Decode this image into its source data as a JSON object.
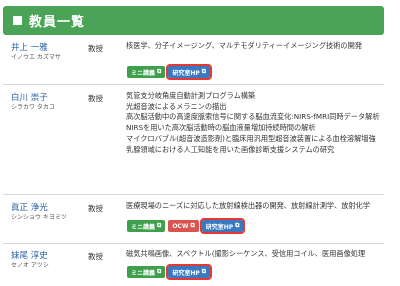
{
  "header": {
    "title": "教員一覧"
  },
  "faculty": [
    {
      "name": "井上 一雅",
      "kana": "イノウエ カズマサ",
      "rank": "教授",
      "topics": [
        "核医学、分子イメージング、マルチモダリティーイメージング技術の開発"
      ],
      "buttons": [
        "ミニ講義",
        "研究室HP"
      ]
    },
    {
      "name": "白川 崇子",
      "kana": "シラカワ タカコ",
      "rank": "教授",
      "topics": [
        "気管支分岐角度自動計測プログラム構築",
        "光超音波によるメラニンの描出",
        "高次脳活動中の高速度脈索信号に関する脳血流変化:NIRS-fMRI同時データ解析",
        "NIRSを用いた高次脳活動時の脳血液量増加持続時間の解析",
        "マイクロバブル(超音波造影剤)と臨床用汎用型超音波装置による血栓溶解増強",
        "乳腺領域における人工知能を用いた画像診断支援システムの研究"
      ],
      "buttons": []
    },
    {
      "name": "眞正 浄光",
      "kana": "シンショウ キヨミツ",
      "rank": "教授",
      "topics": [
        "医療現場のニーズに対応した放射線検出器の開発、放射線計測学、放射化学"
      ],
      "buttons": [
        "ミニ講義",
        "OCW",
        "研究室HP"
      ]
    },
    {
      "name": "妹尾 淳史",
      "kana": "セノオ アツシ",
      "rank": "教授",
      "topics": [
        "磁気共鳴画像、スペクトル(撮影シーケンス、受信用コイル、医用画像処理"
      ],
      "buttons": [
        "ミニ講義",
        "研究室HP"
      ]
    }
  ],
  "icons": {
    "external_link": "external-link-icon"
  },
  "colors": {
    "header": "#4aa356",
    "name": "#2b5fa8",
    "mini": "#3f9f4c",
    "ocw": "#d9534f",
    "hp": "#3a79c0",
    "highlight": "#e53935"
  }
}
